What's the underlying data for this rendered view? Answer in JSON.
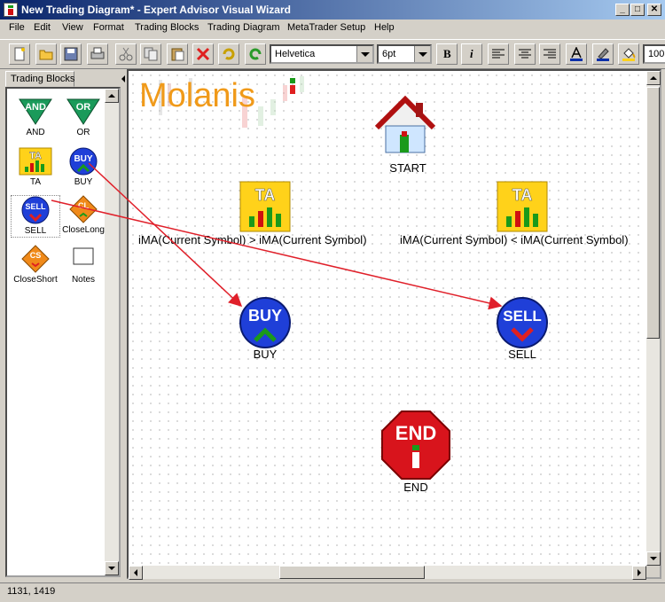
{
  "window": {
    "title": "New Trading Diagram* - Expert Advisor Visual Wizard"
  },
  "menu": [
    "File",
    "Edit",
    "View",
    "Format",
    "Trading Blocks",
    "Trading Diagram",
    "MetaTrader Setup",
    "Help"
  ],
  "toolbar": {
    "font": "Helvetica",
    "size": "6pt",
    "zoom": "100"
  },
  "left_panel": {
    "tab": "Trading Blocks",
    "items": [
      {
        "label": "AND",
        "icon": "and-icon",
        "glyph": "AND"
      },
      {
        "label": "OR",
        "icon": "or-icon",
        "glyph": "OR"
      },
      {
        "label": "TA",
        "icon": "ta-icon",
        "glyph": "TA"
      },
      {
        "label": "BUY",
        "icon": "buy-icon",
        "glyph": "BUY"
      },
      {
        "label": "SELL",
        "icon": "sell-icon",
        "glyph": "SELL"
      },
      {
        "label": "CloseLong",
        "icon": "close-long-icon",
        "glyph": "CL"
      },
      {
        "label": "CloseShort",
        "icon": "close-short-icon",
        "glyph": "CS"
      },
      {
        "label": "Notes",
        "icon": "notes-icon",
        "glyph": ""
      }
    ]
  },
  "canvas": {
    "logo": "Molanis",
    "nodes": {
      "start": {
        "label": "START"
      },
      "ta1": {
        "glyph": "TA",
        "label": "iMA(Current Symbol)  >  iMA(Current Symbol)"
      },
      "ta2": {
        "glyph": "TA",
        "label": "iMA(Current Symbol)  <  iMA(Current Symbol)"
      },
      "buy": {
        "glyph": "BUY",
        "label": "BUY"
      },
      "sell": {
        "glyph": "SELL",
        "label": "SELL"
      },
      "end": {
        "glyph": "END",
        "label": "END"
      }
    }
  },
  "status": {
    "coords": "1131, 1419"
  },
  "colors": {
    "arrow": "#e0202a",
    "buy_blue": "#1f3fd8",
    "ta_yellow": "#ffd21a",
    "end_red": "#d8141c"
  }
}
